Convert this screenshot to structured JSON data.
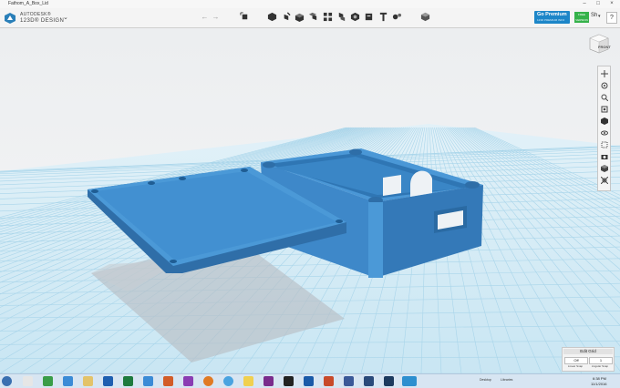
{
  "window": {
    "title": "Fathom_A_Box_Lid",
    "controls": [
      "minimize-icon",
      "maximize-icon",
      "close-icon"
    ]
  },
  "app": {
    "brand_top": "AUTODESK®",
    "brand_bottom": "123D® DESIGN",
    "menu_icon": "chevron-down-icon"
  },
  "toolbar": {
    "undo_icon": "undo-arrow-icon",
    "redo_icon": "redo-arrow-icon",
    "tools": [
      "transform-icon",
      "primitives-icon",
      "sketch-icon",
      "construct-icon",
      "modify-icon",
      "pattern-icon",
      "grouping-icon",
      "combine-icon",
      "measure-icon",
      "text-icon",
      "snap-icon",
      "material-icon"
    ]
  },
  "premium": {
    "label": "Go Premium",
    "sub": "123D PREMIUM INFO",
    "badge": "FREE VERSION",
    "user": "Sh",
    "help": "?"
  },
  "viewcube": {
    "face_label": "FRONT"
  },
  "nav_tools": [
    "pan-icon",
    "orbit-icon",
    "zoom-icon",
    "fit-icon",
    "view-icon",
    "visibility-icon",
    "materials-outline-icon",
    "camera-icon",
    "solid-icon",
    "xray-icon"
  ],
  "grid": {
    "edit_label": "Edit Grid",
    "snap_value": "Off",
    "grid_value": "1",
    "snap_caption": "Linear Snap",
    "grid_caption": "Angular Snap"
  },
  "taskbar": {
    "tray_text": "Desktop",
    "libraries_text": "Libraries",
    "time": "6:38 PM",
    "date": "11/1/2016"
  },
  "colors": {
    "model": "#3f8fd2",
    "grid_lines": "#a9d5ea",
    "accent": "#1d86c8"
  }
}
